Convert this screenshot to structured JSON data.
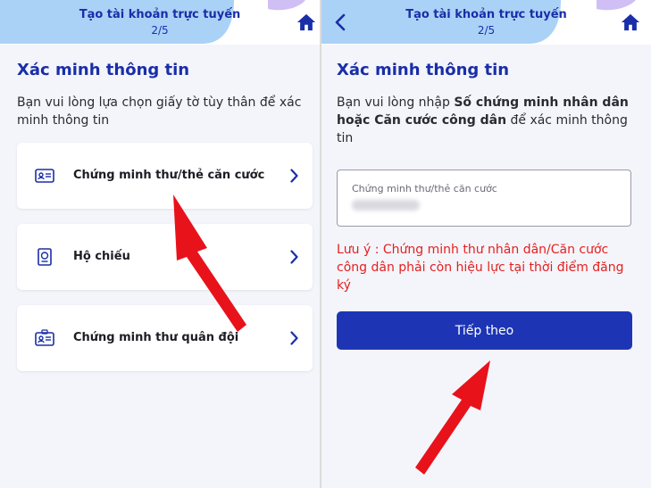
{
  "left": {
    "header": {
      "title": "Tạo tài khoản trực tuyến",
      "step": "2/5"
    },
    "title": "Xác minh thông tin",
    "description": "Bạn vui lòng lựa chọn giấy tờ tùy thân để xác minh thông tin",
    "options": [
      {
        "label": "Chứng minh thư/thẻ căn cước",
        "icon": "id-card-icon"
      },
      {
        "label": "Hộ chiếu",
        "icon": "passport-icon"
      },
      {
        "label": "Chứng minh thư quân đội",
        "icon": "military-id-icon"
      }
    ]
  },
  "right": {
    "header": {
      "title": "Tạo tài khoản trực tuyến",
      "step": "2/5"
    },
    "title": "Xác minh thông tin",
    "description_prefix": "Bạn vui lòng nhập ",
    "description_bold": "Số chứng minh nhân dân hoặc Căn cước công dân",
    "description_suffix": " để xác minh thông tin",
    "field_label": "Chứng minh thư/thẻ căn cước",
    "note": "Lưu ý : Chứng minh thư nhân dân/Căn cước công dân phải còn hiệu lực tại thời điểm đăng ký",
    "button_label": "Tiếp theo"
  },
  "colors": {
    "brand": "#1a2ea8",
    "button": "#1d35b5",
    "warning": "#e52020",
    "annotation_arrow": "#e8121b"
  }
}
